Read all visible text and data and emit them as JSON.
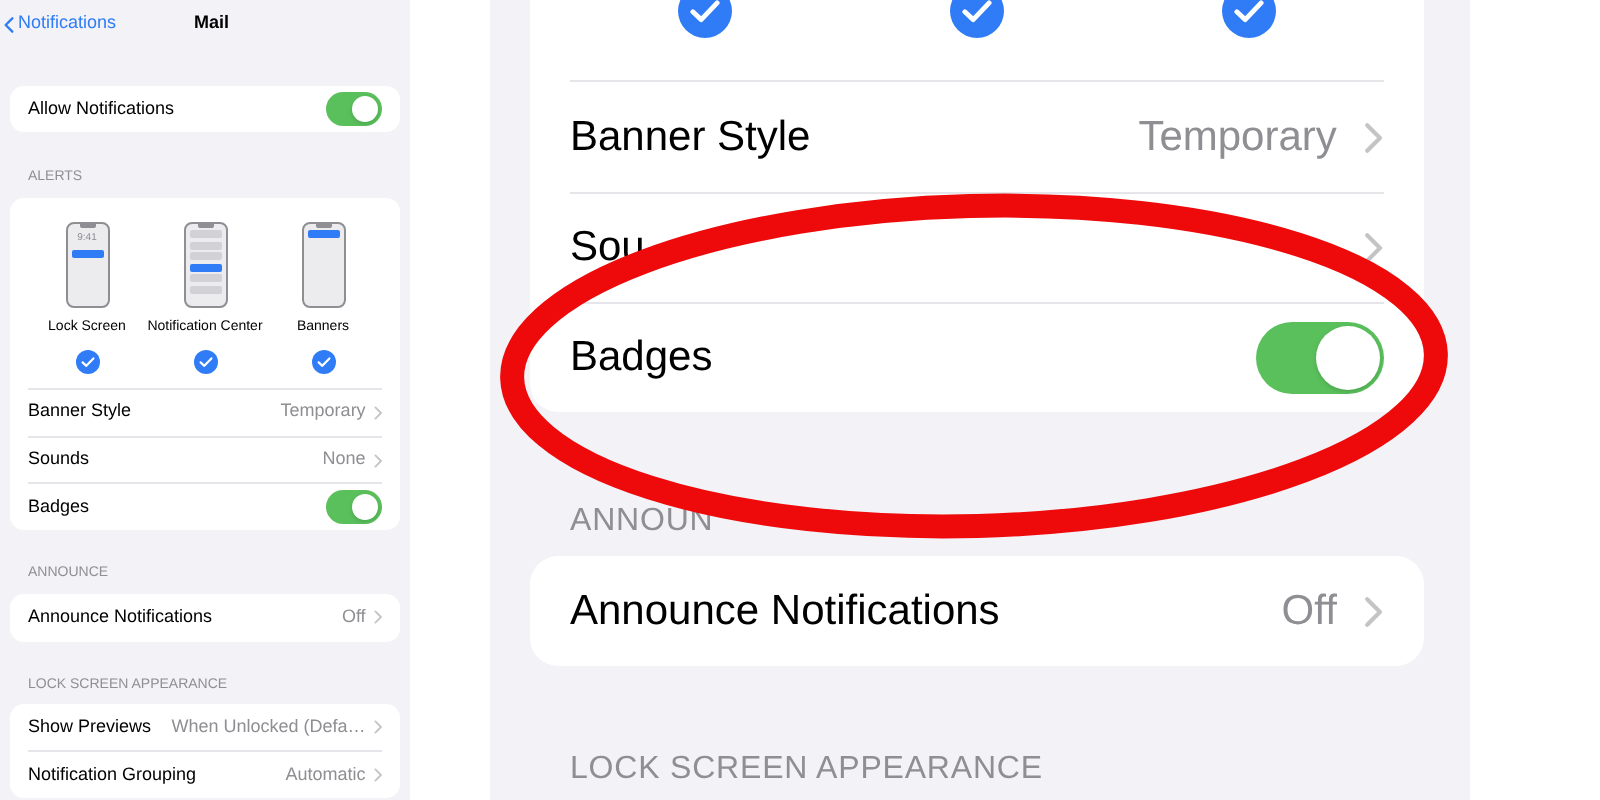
{
  "nav": {
    "back": "Notifications",
    "title": "Mail"
  },
  "allow": {
    "label": "Allow Notifications",
    "on": true
  },
  "alerts": {
    "header": "ALERTS",
    "styles": [
      {
        "kind": "lock",
        "label": "Lock Screen",
        "time": "9:41",
        "checked": true
      },
      {
        "kind": "center",
        "label": "Notification Center",
        "checked": true
      },
      {
        "kind": "banner",
        "label": "Banners",
        "checked": true
      }
    ],
    "rows": [
      {
        "kind": "detail",
        "label": "Banner Style",
        "value": "Temporary"
      },
      {
        "kind": "detail",
        "label": "Sounds",
        "value": "None"
      },
      {
        "kind": "toggle",
        "label": "Badges",
        "on": true
      }
    ]
  },
  "announce": {
    "header": "ANNOUNCE",
    "rows": [
      {
        "kind": "detail",
        "label": "Announce Notifications",
        "value": "Off"
      }
    ]
  },
  "lock_screen": {
    "header": "LOCK SCREEN APPEARANCE",
    "rows": [
      {
        "kind": "detail",
        "label": "Show Previews",
        "value": "When Unlocked (Defa…"
      },
      {
        "kind": "detail",
        "label": "Notification Grouping",
        "value": "Automatic"
      }
    ]
  },
  "zoomed_view": {
    "checks": [
      {
        "checked": true
      },
      {
        "checked": true
      },
      {
        "checked": true
      }
    ],
    "rows": [
      {
        "kind": "detail",
        "label": "Banner Style",
        "value": "Temporary"
      },
      {
        "kind": "detail",
        "label": "Sou"
      },
      {
        "kind": "toggle",
        "label": "Badges",
        "on": true
      }
    ],
    "announce_header": "ANNOUN",
    "announce_rows": [
      {
        "kind": "detail",
        "label": "Announce Notifications",
        "value": "Off"
      }
    ],
    "lock_header": "LOCK SCREEN APPEARANCE"
  }
}
